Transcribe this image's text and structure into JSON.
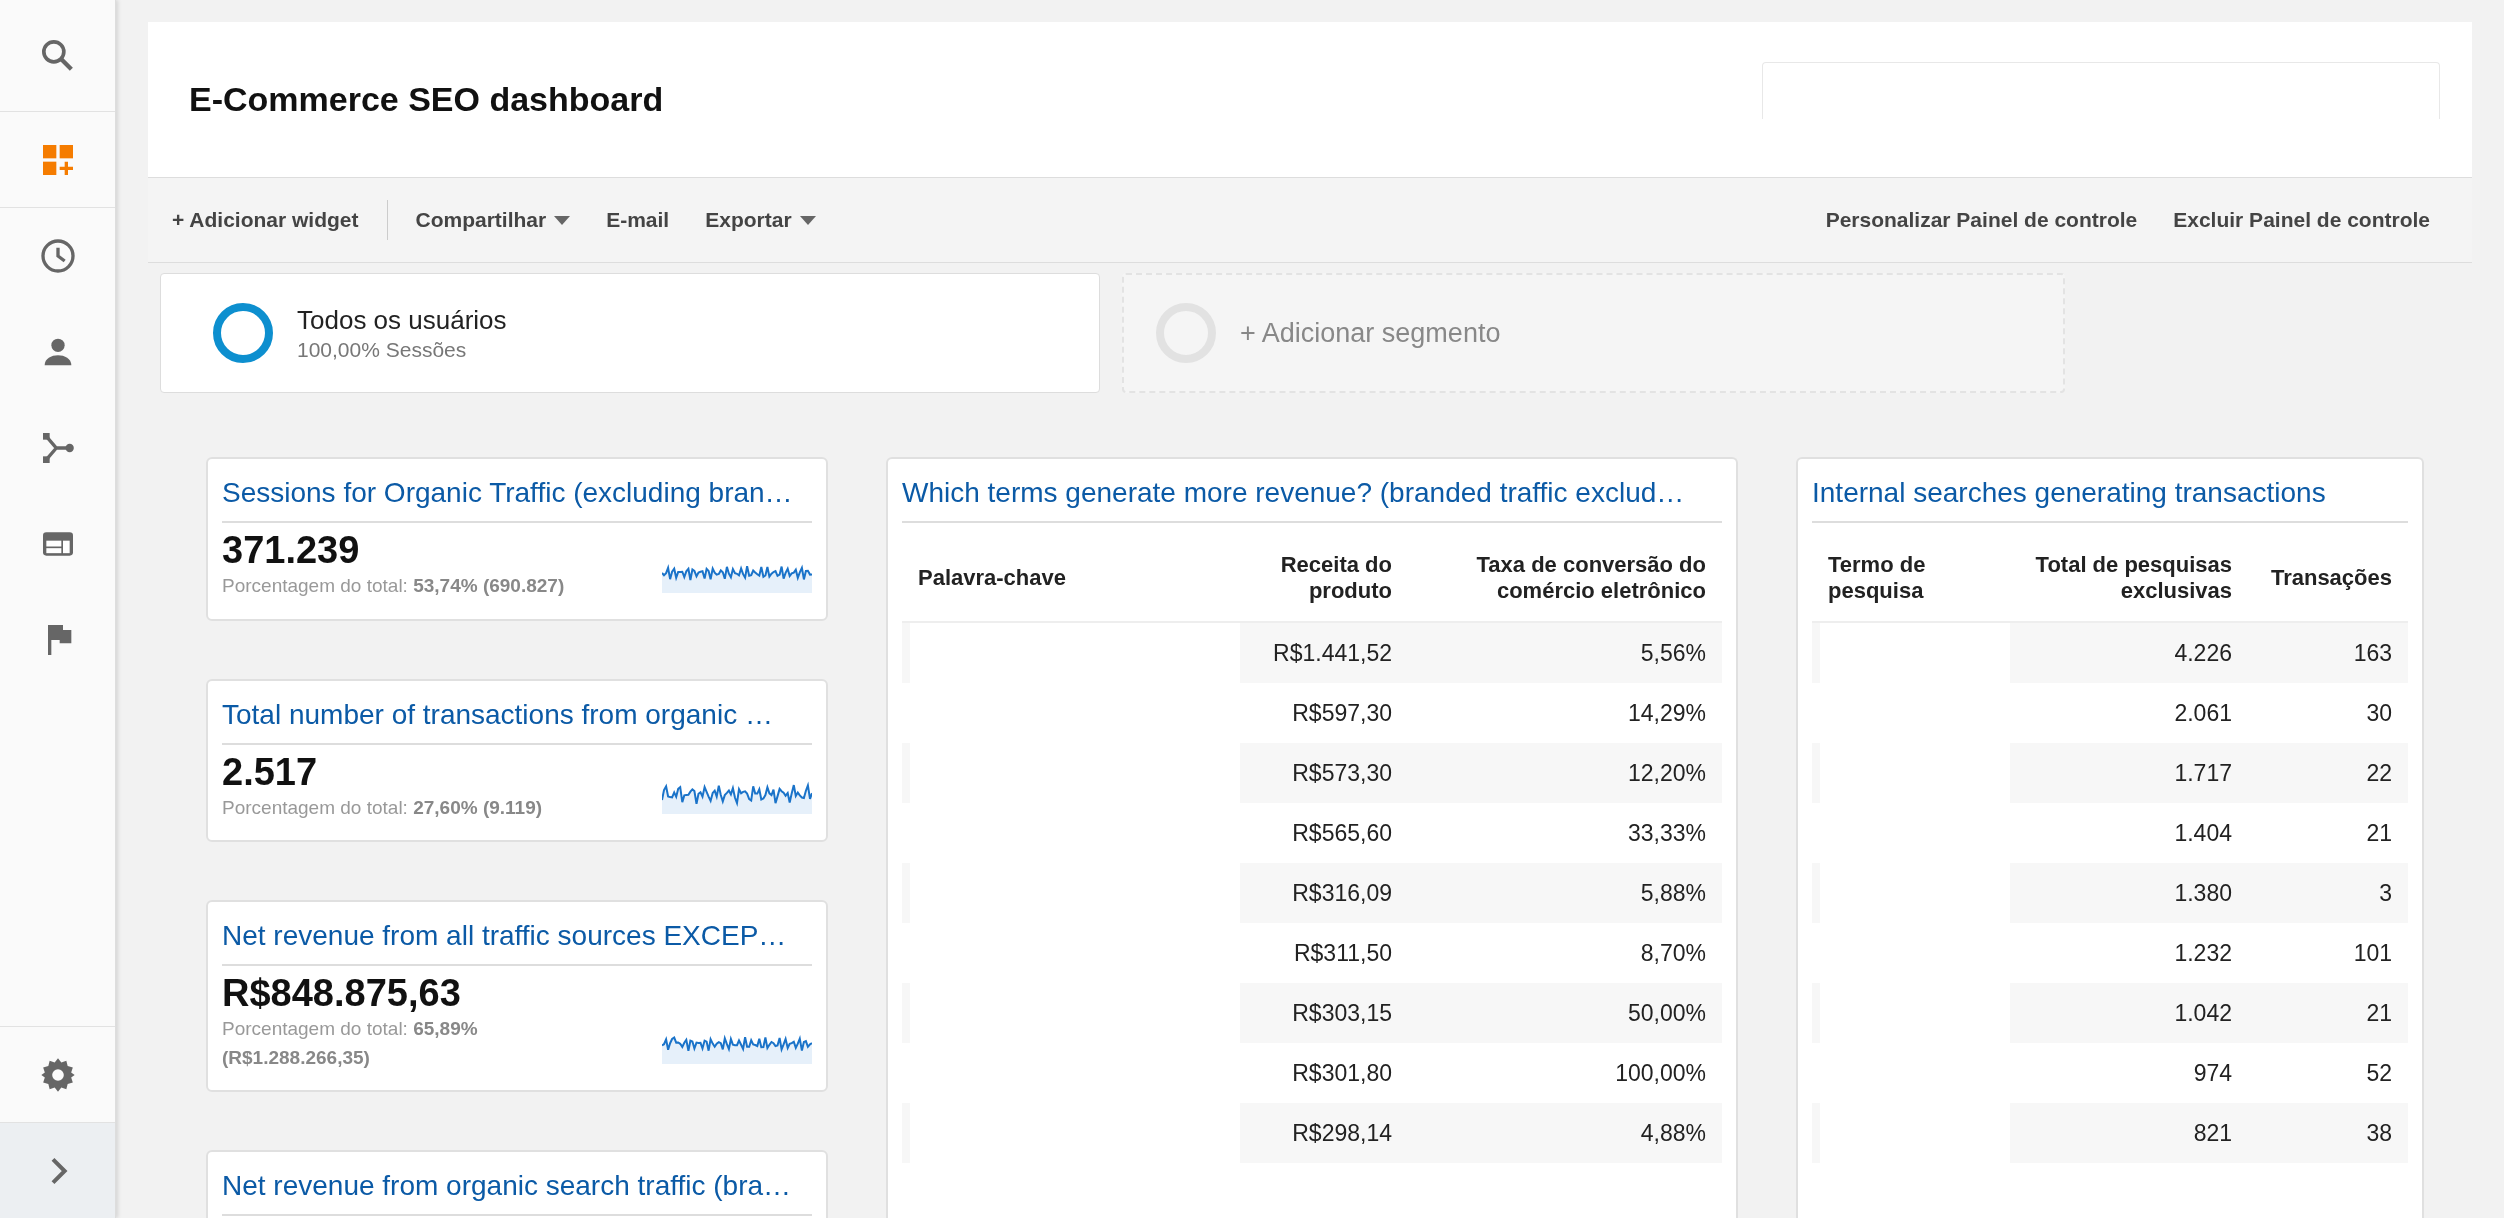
{
  "sidebar": {
    "items": [
      {
        "selected": false
      },
      {
        "selected": true
      },
      {
        "selected": false
      },
      {
        "selected": false
      },
      {
        "selected": false
      },
      {
        "selected": false
      },
      {
        "selected": false
      }
    ],
    "bottom_items": [
      {
        "selected": false
      },
      {
        "selected": false
      }
    ]
  },
  "header": {
    "title": "E-Commerce SEO dashboard"
  },
  "toolbar": {
    "left": [
      {
        "label": "+ Adicionar widget",
        "dropdown": false
      },
      {
        "label": "Compartilhar",
        "dropdown": true
      },
      {
        "label": "E-mail",
        "dropdown": false
      },
      {
        "label": "Exportar",
        "dropdown": true
      }
    ],
    "right": [
      {
        "label": "Personalizar Painel de controle"
      },
      {
        "label": "Excluir Painel de controle"
      }
    ]
  },
  "segments": [
    {
      "kind": "active",
      "name": "Todos os usuários",
      "detail": "100,00% Sessões"
    },
    {
      "kind": "add",
      "name": "+ Adicionar segmento"
    }
  ],
  "metric_widgets": [
    {
      "title": "Sessions for Organic Traffic (excluding bran…",
      "value": "371.239",
      "share": "Porcentagem do total: **53,74% (690.827)**"
    },
    {
      "title": "Total number of transactions from organic …",
      "value": "2.517",
      "share": "Porcentagem do total: **27,60% (9.119)**"
    },
    {
      "title": "Net revenue from all traffic sources EXCEP…",
      "value": "R$848.875,63",
      "share": "Porcentagem do total: **65,89% (R$1.288.266,35)**"
    },
    {
      "title": "Net revenue from organic search traffic (bra…"
    }
  ],
  "table_widgets": [
    {
      "title": "Which terms generate more revenue? (branded traffic exclud…",
      "columns": [
        "Palavra-chave",
        "Receita do produto",
        "Taxa de conversão do comércio eletrônico"
      ],
      "rows": [
        [
          "",
          "R$1.441,52",
          "5,56%"
        ],
        [
          "",
          "R$597,30",
          "14,29%"
        ],
        [
          "",
          "R$573,30",
          "12,20%"
        ],
        [
          "",
          "R$565,60",
          "33,33%"
        ],
        [
          "",
          "R$316,09",
          "5,88%"
        ],
        [
          "",
          "R$311,50",
          "8,70%"
        ],
        [
          "",
          "R$303,15",
          "50,00%"
        ],
        [
          "",
          "R$301,80",
          "100,00%"
        ],
        [
          "",
          "R$298,14",
          "4,88%"
        ]
      ]
    },
    {
      "title": "Internal searches generating transactions",
      "columns": [
        "Termo de pesquisa",
        "Total de pesquisas exclusivas",
        "Transações"
      ],
      "rows": [
        [
          "",
          "4.226",
          "163"
        ],
        [
          "",
          "2.061",
          "30"
        ],
        [
          "",
          "1.717",
          "22"
        ],
        [
          "",
          "1.404",
          "21"
        ],
        [
          "",
          "1.380",
          "3"
        ],
        [
          "",
          "1.232",
          "101"
        ],
        [
          "",
          "1.042",
          "21"
        ],
        [
          "",
          "974",
          "52"
        ],
        [
          "",
          "821",
          "38"
        ]
      ]
    }
  ]
}
